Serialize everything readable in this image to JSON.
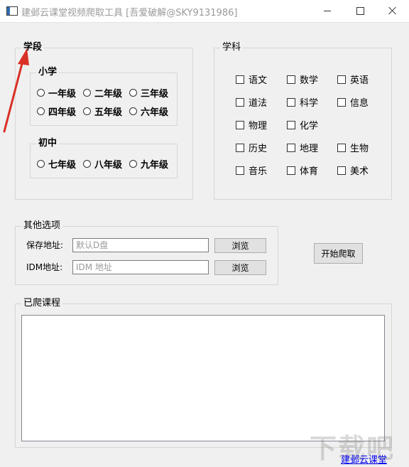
{
  "window": {
    "title": "建邺云课堂视频爬取工具 [吾爱破解@SKY9131986]"
  },
  "grade_group": {
    "title": "学段",
    "primary": {
      "title": "小学",
      "options": [
        "一年级",
        "二年级",
        "三年级",
        "四年级",
        "五年级",
        "六年级"
      ]
    },
    "middle": {
      "title": "初中",
      "options": [
        "七年级",
        "八年级",
        "九年级"
      ]
    }
  },
  "subject_group": {
    "title": "学科",
    "options": [
      "语文",
      "数学",
      "英语",
      "道法",
      "科学",
      "信息",
      "物理",
      "化学",
      "历史",
      "地理",
      "生物",
      "音乐",
      "体育",
      "美术"
    ]
  },
  "other_options": {
    "title": "其他选项",
    "save_label": "保存地址:",
    "save_placeholder": "默认D盘",
    "idm_label": "IDM地址:",
    "idm_placeholder": "IDM 地址",
    "browse_label": "浏览"
  },
  "start_button": "开始爬取",
  "crawled": {
    "title": "已爬课程"
  },
  "footer_link": "建邺云课堂",
  "watermark": "下载吧",
  "colors": {
    "annotation_arrow": "#d93025",
    "link": "#0000ee"
  }
}
